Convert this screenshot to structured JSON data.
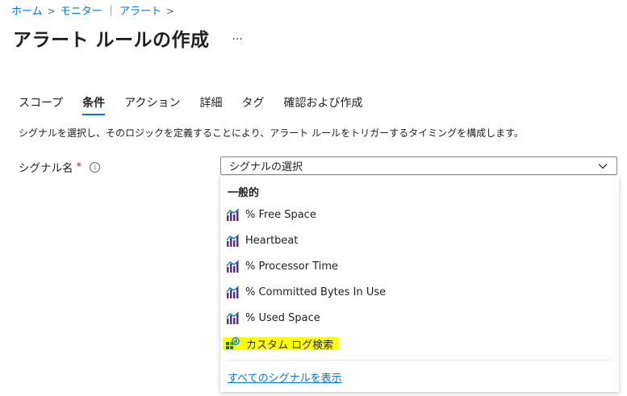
{
  "breadcrumb": {
    "home": "ホーム",
    "monitor": "モニター ｜ アラート",
    "separator": ">"
  },
  "page": {
    "title": "アラート ルールの作成",
    "more": "···"
  },
  "tabs": [
    {
      "label": "スコープ",
      "active": false
    },
    {
      "label": "条件",
      "active": true
    },
    {
      "label": "アクション",
      "active": false
    },
    {
      "label": "詳細",
      "active": false
    },
    {
      "label": "タグ",
      "active": false
    },
    {
      "label": "確認および作成",
      "active": false
    }
  ],
  "description": "シグナルを選択し、そのロジックを定義することにより、アラート ルールをトリガーするタイミングを構成します。",
  "signal_field": {
    "label": "シグナル名",
    "required_marker": "*",
    "info": "i",
    "placeholder": "シグナルの選択"
  },
  "dropdown": {
    "group_header": "一般的",
    "items": [
      {
        "label": "% Free Space",
        "icon": "metric-chart-icon"
      },
      {
        "label": "Heartbeat",
        "icon": "metric-chart-icon"
      },
      {
        "label": "% Processor Time",
        "icon": "metric-chart-icon"
      },
      {
        "label": "% Committed Bytes In Use",
        "icon": "metric-chart-icon"
      },
      {
        "label": "% Used Space",
        "icon": "metric-chart-icon"
      },
      {
        "label": "カスタム ログ検索",
        "icon": "log-search-icon",
        "highlighted": true
      }
    ],
    "show_all": "すべてのシグナルを表示"
  },
  "colors": {
    "accent": "#0078d4",
    "highlight": "#ffff00",
    "required": "#a4262c"
  }
}
